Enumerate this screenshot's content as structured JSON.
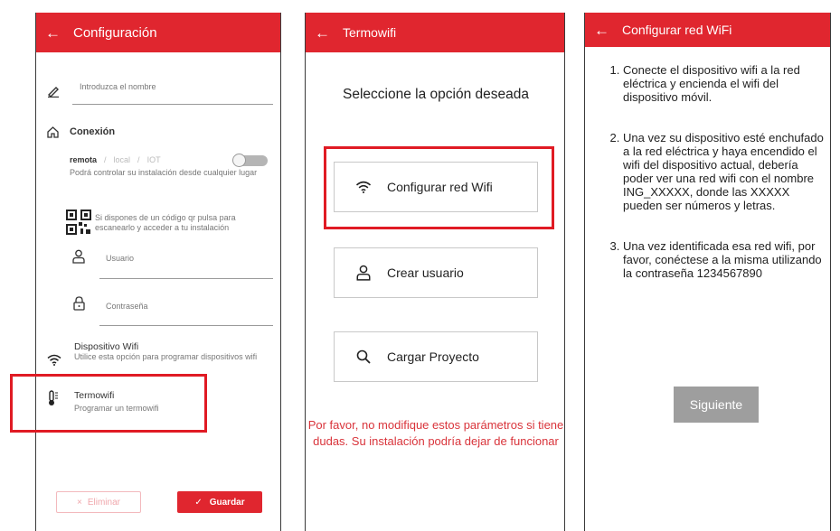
{
  "colors": {
    "accent": "#e0262f",
    "highlight": "#e01b24"
  },
  "config": {
    "title": "Configuración",
    "back_icon": "arrow-left-icon",
    "name_placeholder": "Introduzca el nombre",
    "connection_title": "Conexión",
    "mode_remote": "remota",
    "mode_sep1": "/",
    "mode_local": "local",
    "mode_sep2": "/",
    "mode_iot": "IOT",
    "remote_desc": "Podrá controlar su instalación desde cualquier lugar",
    "qr_desc": "Si dispones de un código qr pulsa para escanearlo y acceder a tu instalación",
    "user_placeholder": "Usuario",
    "password_placeholder": "Contraseña",
    "wifi_device_title": "Dispositivo Wifi",
    "wifi_device_desc": "Utilice esta opción para programar dispositivos wifi",
    "termowifi_title": "Termowifi",
    "termowifi_desc": "Programar un termowifi",
    "delete_label": "Eliminar",
    "delete_icon": "×",
    "save_label": "Guardar",
    "save_icon": "✓"
  },
  "termowifi": {
    "title": "Termowifi",
    "prompt": "Seleccione la opción deseada",
    "options": [
      {
        "label": "Configurar red Wifi",
        "icon": "wifi-icon"
      },
      {
        "label": "Crear usuario",
        "icon": "user-icon"
      },
      {
        "label": "Cargar Proyecto",
        "icon": "search-icon"
      }
    ],
    "warning": "Por favor, no modifique estos parámetros si tiene dudas. Su instalación podría dejar de funcionar"
  },
  "wifi_setup": {
    "title": "Configurar red WiFi",
    "steps": [
      "Conecte el dispositivo wifi a la red eléctrica y encienda el wifi del dispositivo móvil.",
      "Una vez su dispositivo esté enchufado a la red eléctrica y haya encendido el wifi del dispositivo actual, debería poder ver una red wifi con el nombre ING_XXXXX, donde las XXXXX pueden ser números y letras.",
      "Una vez identificada esa red wifi, por favor, conéctese a la misma utilizando la contraseña 1234567890"
    ],
    "next_label": "Siguiente"
  }
}
